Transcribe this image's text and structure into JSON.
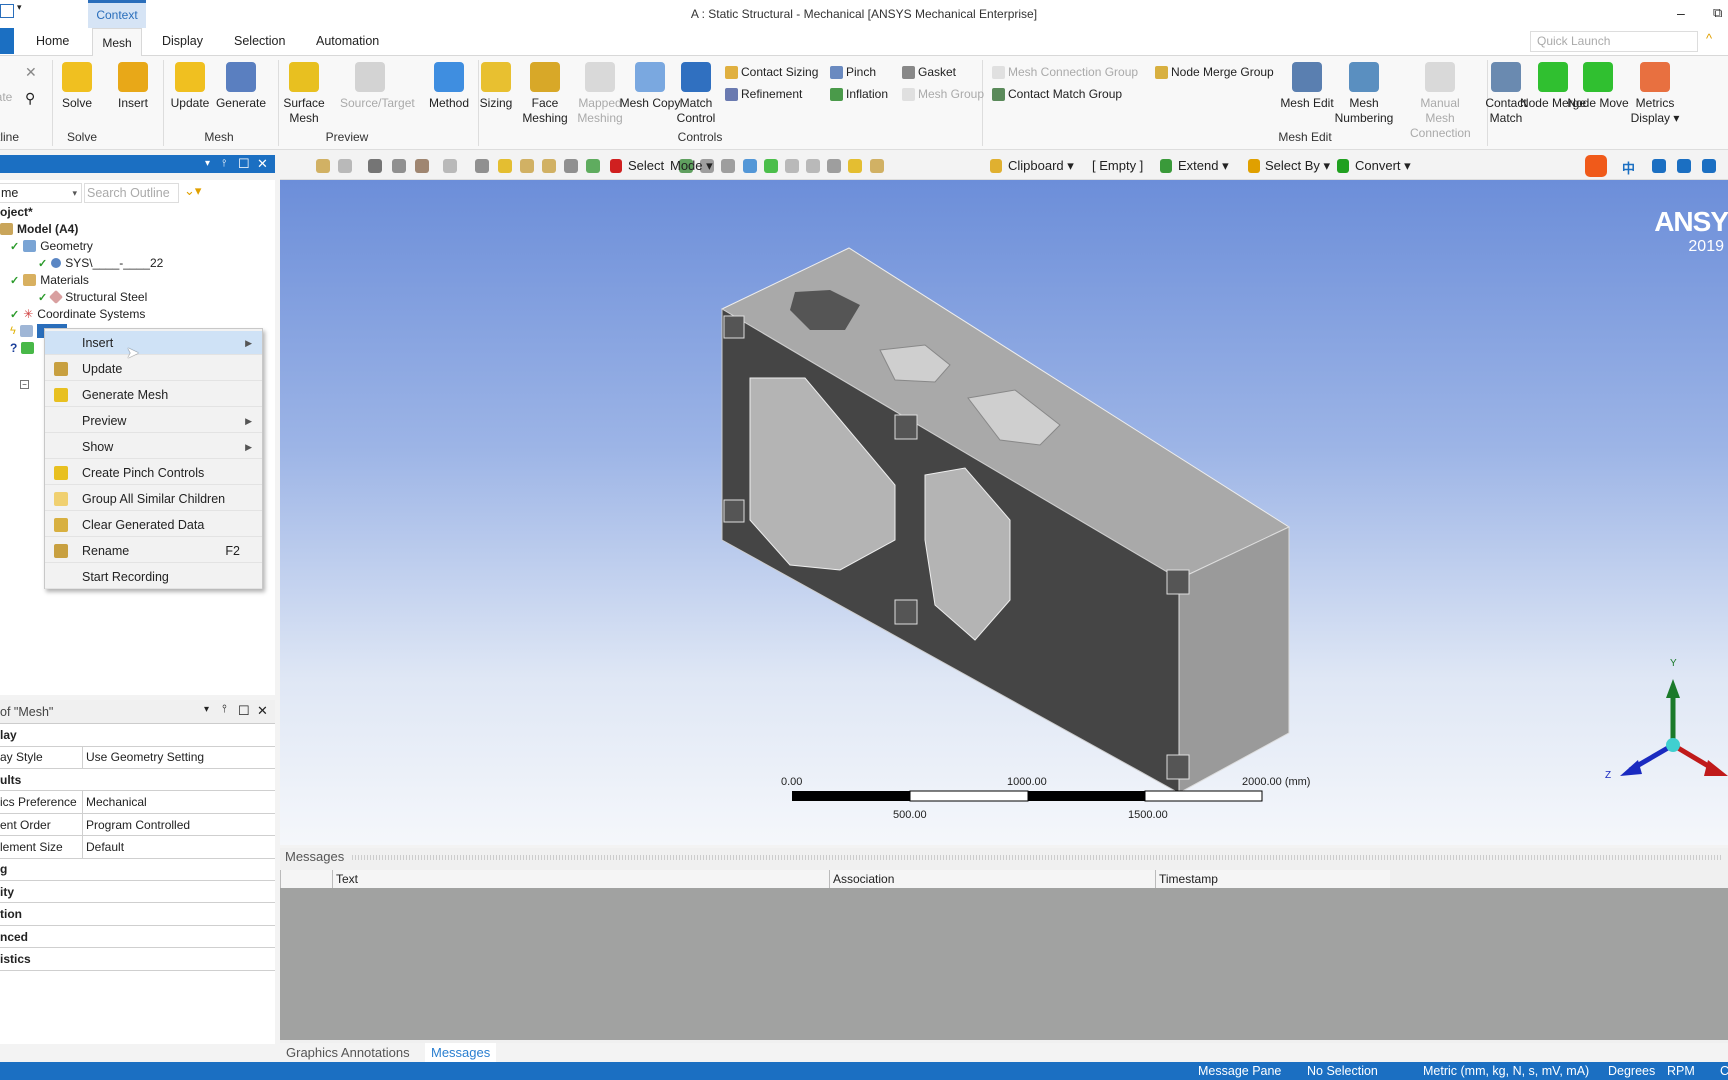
{
  "title_bar": {
    "context_tab": "Context",
    "title": "A : Static Structural - Mechanical [ANSYS Mechanical Enterprise]",
    "minimize": "–",
    "restore": "⧉"
  },
  "tabs": [
    "Home",
    "Mesh",
    "Display",
    "Selection",
    "Automation"
  ],
  "active_tab": "Mesh",
  "quick_launch": {
    "placeholder": "Quick Launch"
  },
  "ribbon": {
    "partial": {
      "button": "ate",
      "group": "tline"
    },
    "groups": [
      {
        "label": "Solve",
        "items": [
          {
            "label": "Solve",
            "icon": "lightning-icon"
          }
        ]
      },
      {
        "label": "",
        "items": [
          {
            "label": "Insert",
            "icon": "plus-icon"
          }
        ]
      },
      {
        "label": "Mesh",
        "items": [
          {
            "label": "Update",
            "icon": "update-icon"
          },
          {
            "label": "Generate",
            "icon": "generate-icon"
          }
        ]
      },
      {
        "label": "Preview",
        "items": [
          {
            "label": "Surface Mesh",
            "icon": "surface-mesh-icon"
          },
          {
            "label": "Source/Target",
            "icon": "source-target-icon",
            "disabled": true
          }
        ]
      },
      {
        "label": "Controls",
        "items": [
          {
            "label": "Method",
            "icon": "method-icon"
          },
          {
            "label": "Sizing",
            "icon": "sizing-icon"
          },
          {
            "label": "Face Meshing",
            "icon": "face-meshing-icon"
          },
          {
            "label": "Mapped Meshing",
            "icon": "mapped-meshing-icon",
            "disabled": true
          },
          {
            "label": "Mesh Copy",
            "icon": "mesh-copy-icon"
          },
          {
            "label": "Match Control",
            "icon": "match-control-icon"
          }
        ],
        "small": [
          {
            "label": "Contact Sizing"
          },
          {
            "label": "Pinch"
          },
          {
            "label": "Gasket"
          },
          {
            "label": "Refinement"
          },
          {
            "label": "Inflation"
          },
          {
            "label": "Mesh Group",
            "disabled": true
          }
        ]
      },
      {
        "label": "Mesh Edit",
        "small": [
          {
            "label": "Mesh Connection Group",
            "disabled": true
          },
          {
            "label": "Node Merge Group"
          },
          {
            "label": "Contact Match Group"
          }
        ],
        "items": [
          {
            "label": "Mesh Edit"
          },
          {
            "label": "Mesh Numbering"
          },
          {
            "label": "Manual Mesh Connection",
            "disabled": true
          },
          {
            "label": "Contact Match"
          },
          {
            "label": "Node Merge"
          },
          {
            "label": "Node Move"
          }
        ]
      },
      {
        "label": "",
        "items": [
          {
            "label": "Metrics Display ▾"
          }
        ]
      }
    ]
  },
  "toolbar": {
    "select": "Select",
    "mode": "Mode ▾",
    "clipboard": "Clipboard ▾",
    "empty": "[ Empty ]",
    "extend": "Extend ▾",
    "select_by": "Select By ▾",
    "convert": "Convert ▾"
  },
  "ime": {
    "chinese": "中"
  },
  "outline": {
    "header_controls": [
      "▾",
      "📌",
      "☐",
      "✕"
    ],
    "filter_combo": "me",
    "search_placeholder": "Search Outline",
    "tree": [
      "oject*",
      "Model (A4)",
      "Geometry",
      "SYS\\____-____22",
      "Materials",
      "Structural Steel",
      "Coordinate Systems"
    ]
  },
  "context_menu": [
    {
      "label": "Insert",
      "submenu": true,
      "highlighted": true
    },
    {
      "label": "Update"
    },
    {
      "label": "Generate Mesh"
    },
    {
      "label": "Preview",
      "submenu": true
    },
    {
      "label": "Show",
      "submenu": true
    },
    {
      "label": "Create Pinch Controls"
    },
    {
      "label": "Group All Similar Children"
    },
    {
      "label": "Clear Generated Data"
    },
    {
      "label": "Rename",
      "shortcut": "F2"
    },
    {
      "label": "Start Recording"
    }
  ],
  "viewport": {
    "logo": "ANSY",
    "version": "2019",
    "scale_bar": {
      "top": [
        "0.00",
        "1000.00",
        "2000.00 (mm)"
      ],
      "bottom": [
        "500.00",
        "1500.00"
      ]
    },
    "triad": {
      "y": "Y",
      "z": "Z"
    }
  },
  "details": {
    "title": "of \"Mesh\"",
    "rows": [
      {
        "k": "lay",
        "cat": true
      },
      {
        "k": "ay Style",
        "v": "Use Geometry Setting"
      },
      {
        "k": "ults",
        "cat": true
      },
      {
        "k": "ics Preference",
        "v": "Mechanical"
      },
      {
        "k": "ent Order",
        "v": "Program Controlled"
      },
      {
        "k": "lement Size",
        "v": "Default"
      },
      {
        "k": "g",
        "cat": true
      },
      {
        "k": "ity",
        "cat": true
      },
      {
        "k": "tion",
        "cat": true
      },
      {
        "k": "nced",
        "cat": true
      },
      {
        "k": "istics",
        "cat": true
      }
    ]
  },
  "messages": {
    "title": "Messages",
    "columns": [
      "Text",
      "Association",
      "Timestamp"
    ]
  },
  "bottom_tabs": [
    "Graphics Annotations",
    "Messages"
  ],
  "status_bar": [
    "Message Pane",
    "No Selection",
    "Metric (mm, kg, N, s, mV, mA)",
    "Degrees",
    "RPM",
    "C"
  ],
  "colors": {
    "accent": "#1b6fc2",
    "viewport_top": "#6c8ed9",
    "model_dark": "#444444",
    "model_light": "#a8a8a8"
  }
}
